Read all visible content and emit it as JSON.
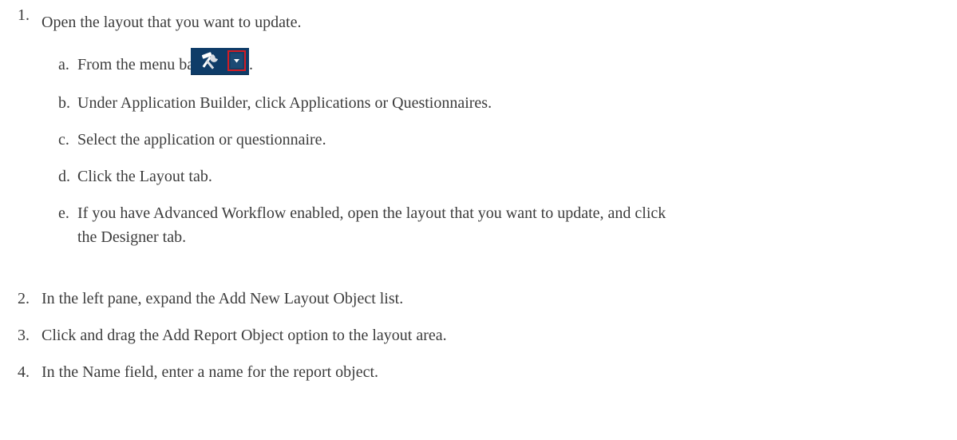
{
  "steps": [
    {
      "number": "1.",
      "text": "Open the layout that you want to update.",
      "substeps": [
        {
          "letter": "a.",
          "text_before_icon": "From the menu bar, click",
          "text_after_icon": ".",
          "icon": "tools-menu-dropdown-icon"
        },
        {
          "letter": "b.",
          "text": "Under Application Builder, click Applications or Questionnaires."
        },
        {
          "letter": "c.",
          "text": "Select the application or questionnaire."
        },
        {
          "letter": "d.",
          "text": "Click the Layout tab."
        },
        {
          "letter": "e.",
          "text_line1": "If you have Advanced Workflow enabled, open the layout that you want to update, and click",
          "text_line2": "the Designer tab."
        }
      ]
    },
    {
      "number": "2.",
      "text": "In the left pane, expand the Add New Layout Object list."
    },
    {
      "number": "3.",
      "text": "Click and drag the Add Report Object option to the layout area."
    },
    {
      "number": "4.",
      "text": "In the Name field, enter a name for the report object."
    }
  ],
  "colors": {
    "text": "#3c3c3c",
    "toolbar_bg": "#0e3c68",
    "highlight_border": "#d21c24"
  }
}
